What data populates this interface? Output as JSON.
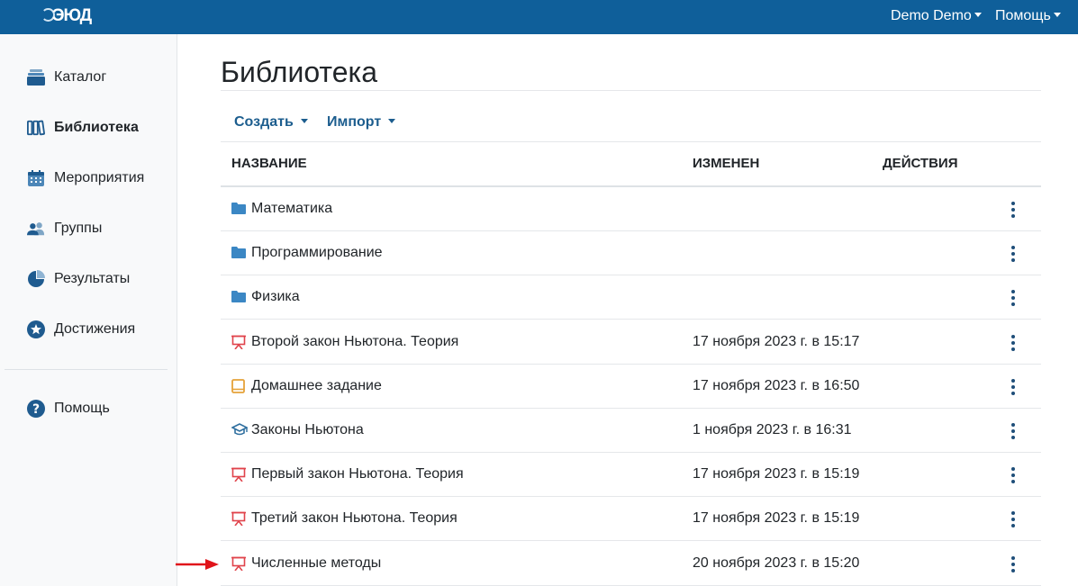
{
  "header": {
    "logo_text": "ЭЮД",
    "user_menu": "Demo Demo",
    "help_menu": "Помощь"
  },
  "sidebar": {
    "items": [
      {
        "label": "Каталог",
        "icon": "catalog-icon"
      },
      {
        "label": "Библиотека",
        "icon": "library-icon",
        "active": true
      },
      {
        "label": "Мероприятия",
        "icon": "calendar-icon"
      },
      {
        "label": "Группы",
        "icon": "users-icon"
      },
      {
        "label": "Результаты",
        "icon": "pie-chart-icon"
      },
      {
        "label": "Достижения",
        "icon": "star-badge-icon"
      }
    ],
    "help": {
      "label": "Помощь",
      "icon": "question-circle-icon"
    }
  },
  "main": {
    "title": "Библиотека",
    "toolbar": {
      "create_label": "Создать",
      "import_label": "Импорт"
    },
    "columns": {
      "name": "НАЗВАНИЕ",
      "modified": "ИЗМЕНЕН",
      "actions": "ДЕЙСТВИЯ"
    },
    "rows": [
      {
        "name": "Математика",
        "date": "",
        "icon": "folder-icon"
      },
      {
        "name": "Программирование",
        "date": "",
        "icon": "folder-icon"
      },
      {
        "name": "Физика",
        "date": "",
        "icon": "folder-icon"
      },
      {
        "name": "Второй закон Ньютона. Теория",
        "date": "17 ноября 2023 г. в 15:17",
        "icon": "presentation-icon"
      },
      {
        "name": "Домашнее задание",
        "date": "17 ноября 2023 г. в 16:50",
        "icon": "book-icon"
      },
      {
        "name": "Законы Ньютона",
        "date": "1 ноября 2023 г. в 16:31",
        "icon": "graduation-cap-icon"
      },
      {
        "name": "Первый закон Ньютона. Теория",
        "date": "17 ноября 2023 г. в 15:19",
        "icon": "presentation-icon"
      },
      {
        "name": "Третий закон Ньютона. Теория",
        "date": "17 ноября 2023 г. в 15:19",
        "icon": "presentation-icon"
      },
      {
        "name": "Численные методы",
        "date": "20 ноября 2023 г. в 15:20",
        "icon": "presentation-icon"
      }
    ]
  },
  "colors": {
    "header_bg": "#0f5f9a",
    "accent": "#1c5d8e",
    "folder": "#3b87c4",
    "presentation": "#e0434b",
    "book": "#e5a23a",
    "arrow": "#e0141a"
  }
}
